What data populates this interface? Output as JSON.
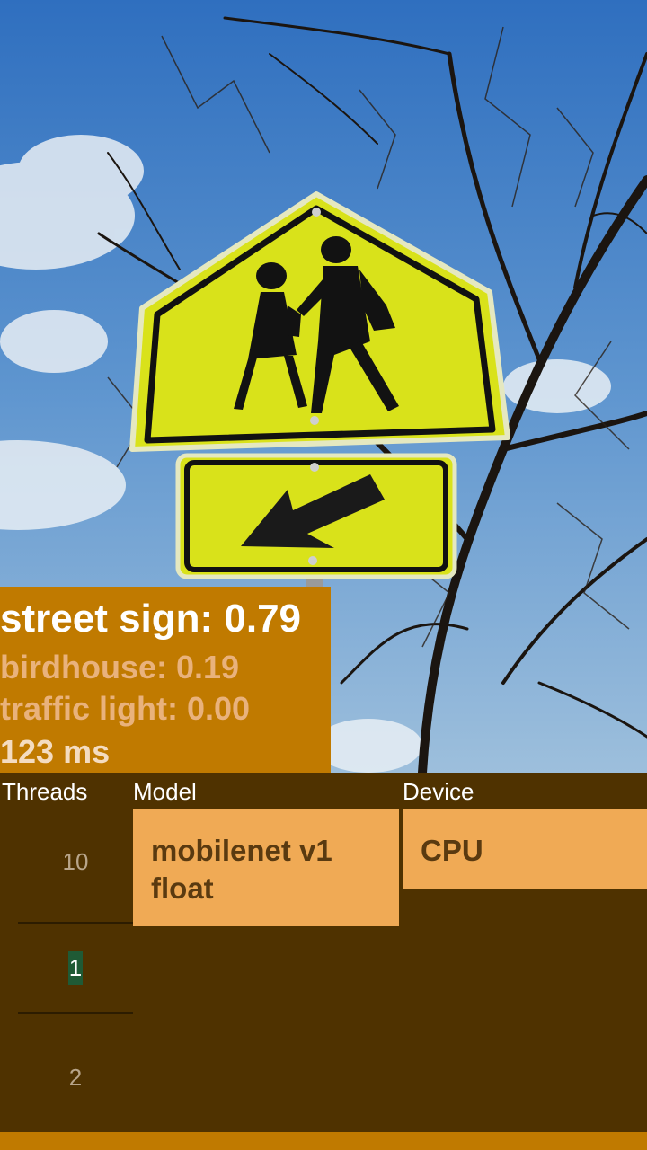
{
  "results": {
    "top": "street sign: 0.79",
    "second": "birdhouse: 0.19",
    "third": "traffic light: 0.00",
    "inference_time": "123 ms"
  },
  "controls": {
    "threads_label": "Threads",
    "model_label": "Model",
    "device_label": "Device",
    "thread_options": [
      "10",
      "1",
      "2"
    ],
    "model_selected": "mobilenet v1 float",
    "device_selected": "CPU"
  },
  "colors": {
    "result_bg": "#c07a00",
    "panel_bg": "#4f3200",
    "tile_bg": "#f0aa55",
    "selected_highlight": "#1f5a35"
  }
}
